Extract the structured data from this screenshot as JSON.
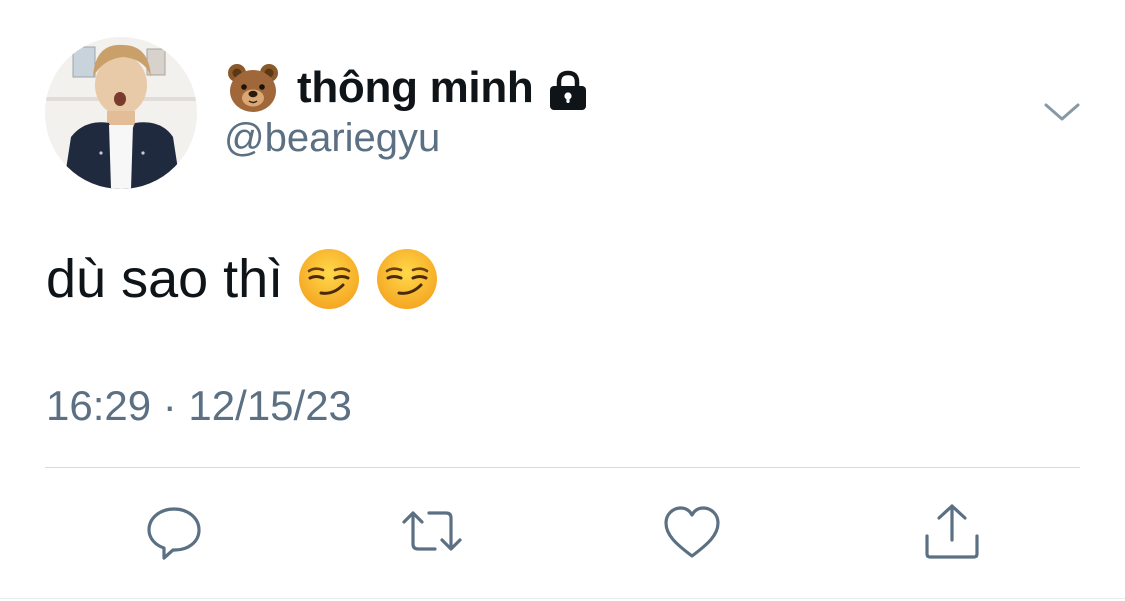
{
  "tweet": {
    "author": {
      "display_name": "thông minh",
      "handle": "@beariegyu",
      "name_prefix_emoji": "bear-face",
      "protected_account": true
    },
    "text": "dù sao thì",
    "text_emojis": [
      "smirking-face",
      "smirking-face"
    ],
    "timestamp": "16:29 · 12/15/23"
  },
  "actions": [
    "reply-icon",
    "retweet-icon",
    "like-icon",
    "share-icon"
  ],
  "colors": {
    "primary_text": "#0f1419",
    "secondary_text": "#5b7083",
    "divider": "#d5dbe0",
    "icon": "#5b7083"
  }
}
